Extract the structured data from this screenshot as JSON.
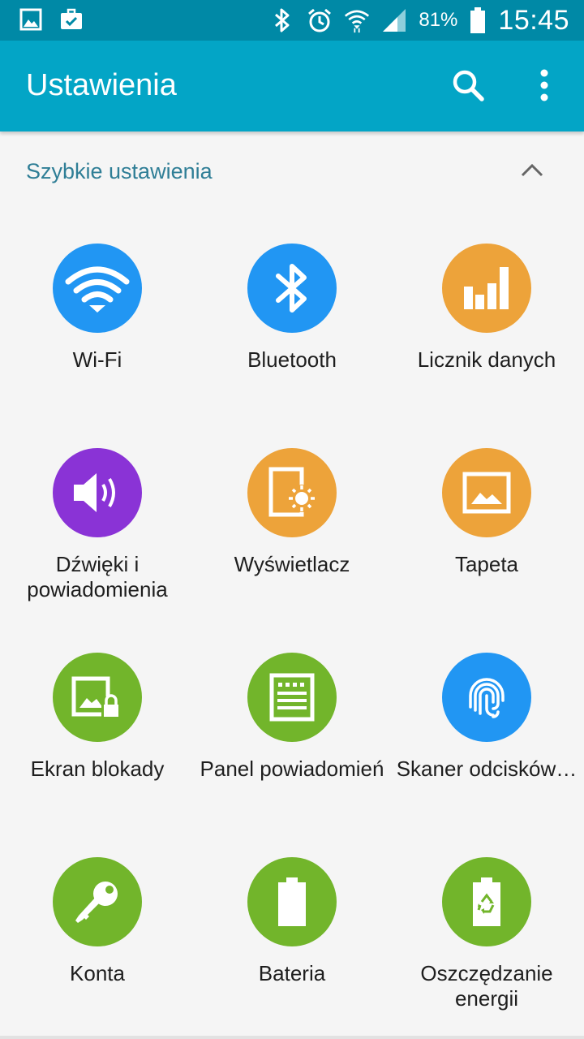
{
  "status_bar": {
    "battery_percent": "81%",
    "time": "15:45",
    "icons": [
      "gallery-icon",
      "briefcase-icon",
      "bluetooth-icon",
      "alarm-icon",
      "wifi-icon",
      "signal-icon",
      "battery-icon"
    ]
  },
  "app_bar": {
    "title": "Ustawienia",
    "actions": [
      "search-icon",
      "more-vert-icon"
    ],
    "color": "#03a5c6"
  },
  "quick_settings": {
    "title": "Szybkie ustawienia",
    "collapse_icon": "chevron-up-icon",
    "items": [
      {
        "label": "Wi-Fi",
        "icon": "wifi-icon",
        "color": "#2196f3"
      },
      {
        "label": "Bluetooth",
        "icon": "bluetooth-icon",
        "color": "#2196f3"
      },
      {
        "label": "Licznik danych",
        "icon": "data-usage-icon",
        "color": "#eda33a"
      },
      {
        "label": "Dźwięki i powiadomienia",
        "icon": "speaker-icon",
        "color": "#8a33d6"
      },
      {
        "label": "Wyświetlacz",
        "icon": "display-icon",
        "color": "#eda33a"
      },
      {
        "label": "Tapeta",
        "icon": "wallpaper-icon",
        "color": "#eda33a"
      },
      {
        "label": "Ekran blokady",
        "icon": "lock-screen-icon",
        "color": "#72b52b"
      },
      {
        "label": "Panel powiadomień",
        "icon": "notification-panel-icon",
        "color": "#72b52b"
      },
      {
        "label": "Skaner odcisków…",
        "icon": "fingerprint-icon",
        "color": "#2196f3"
      },
      {
        "label": "Konta",
        "icon": "key-icon",
        "color": "#72b52b"
      },
      {
        "label": "Bateria",
        "icon": "battery-icon",
        "color": "#72b52b"
      },
      {
        "label": "Oszczędzanie energii",
        "icon": "power-saving-icon",
        "color": "#72b52b"
      }
    ]
  }
}
